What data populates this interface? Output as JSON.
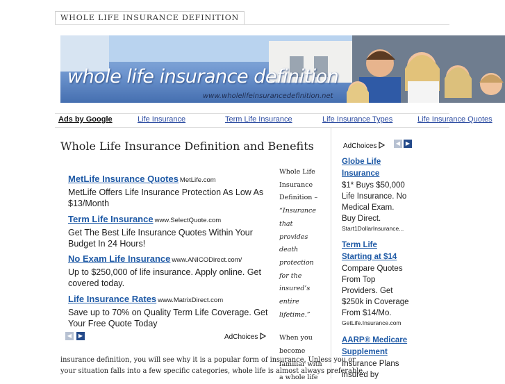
{
  "site": {
    "tab_title": "WHOLE LIFE INSURANCE DEFINITION",
    "banner_title": "whole life insurance definition",
    "banner_url": "www.wholelifeinsurancedefinition.net"
  },
  "nav": {
    "ads_label": "Ads by Google",
    "links": [
      "Life Insurance",
      "Term Life Insurance",
      "Life Insurance Types",
      "Life Insurance Quotes"
    ]
  },
  "main": {
    "heading": "Whole Life Insurance Definition and Benefits",
    "ads": [
      {
        "title": "MetLife Insurance Quotes",
        "url": "MetLife.com",
        "desc": "MetLife Offers Life Insurance Protection As Low As $13/Month"
      },
      {
        "title": "Term Life Insurance",
        "url": "www.SelectQuote.com",
        "desc": "Get The Best Life Insurance Quotes Within Your Budget In 24 Hours!"
      },
      {
        "title": "No Exam Life Insurance",
        "url": "www.ANICODirect.com/",
        "desc": "Up to $250,000 of life insurance. Apply online. Get covered today."
      },
      {
        "title": "Life Insurance Rates",
        "url": "www.MatrixDirect.com",
        "desc": "Save up to 70% on Quality Term Life Coverage. Get Your Free Quote Today"
      }
    ],
    "adchoices": "AdChoices",
    "side_lines": [
      "Whole Life",
      "Insurance",
      "Definition –"
    ],
    "side_quote": [
      "“Insurance",
      "that provides",
      "death",
      "protection",
      "for the",
      "insured’s",
      "entire",
      "lifetime.”"
    ],
    "side_lines2": [
      "When you",
      "become",
      "familiar with",
      "a whole life"
    ],
    "body_lines": [
      "insurance definition, you will see why it is a popular form of insurance.  Unless you or",
      "your situation falls into a few specific categories, whole life is almost always preferable."
    ]
  },
  "right": {
    "adchoices": "AdChoices",
    "ads": [
      {
        "title_lines": [
          "Globe Life",
          "Insurance"
        ],
        "desc_lines": [
          "$1* Buys $50,000",
          "Life Insurance. No",
          "Medical Exam.",
          "Buy Direct."
        ],
        "url": "Start1DollarInsurance..."
      },
      {
        "title_lines": [
          "Term Life",
          "Starting at $14"
        ],
        "desc_lines": [
          "Compare Quotes",
          "From Top",
          "Providers. Get",
          "$250k in Coverage",
          "From $14/Mo."
        ],
        "url": "GetLife.Insurance.com"
      },
      {
        "title_lines": [
          "AARP® Medicare",
          "Supplement"
        ],
        "desc_lines": [
          "Insurance Plans",
          "insured by"
        ],
        "url": ""
      }
    ]
  },
  "icons": {
    "prev": "chevron-left-icon",
    "next": "chevron-right-icon",
    "adchoices": "adchoices-icon"
  }
}
